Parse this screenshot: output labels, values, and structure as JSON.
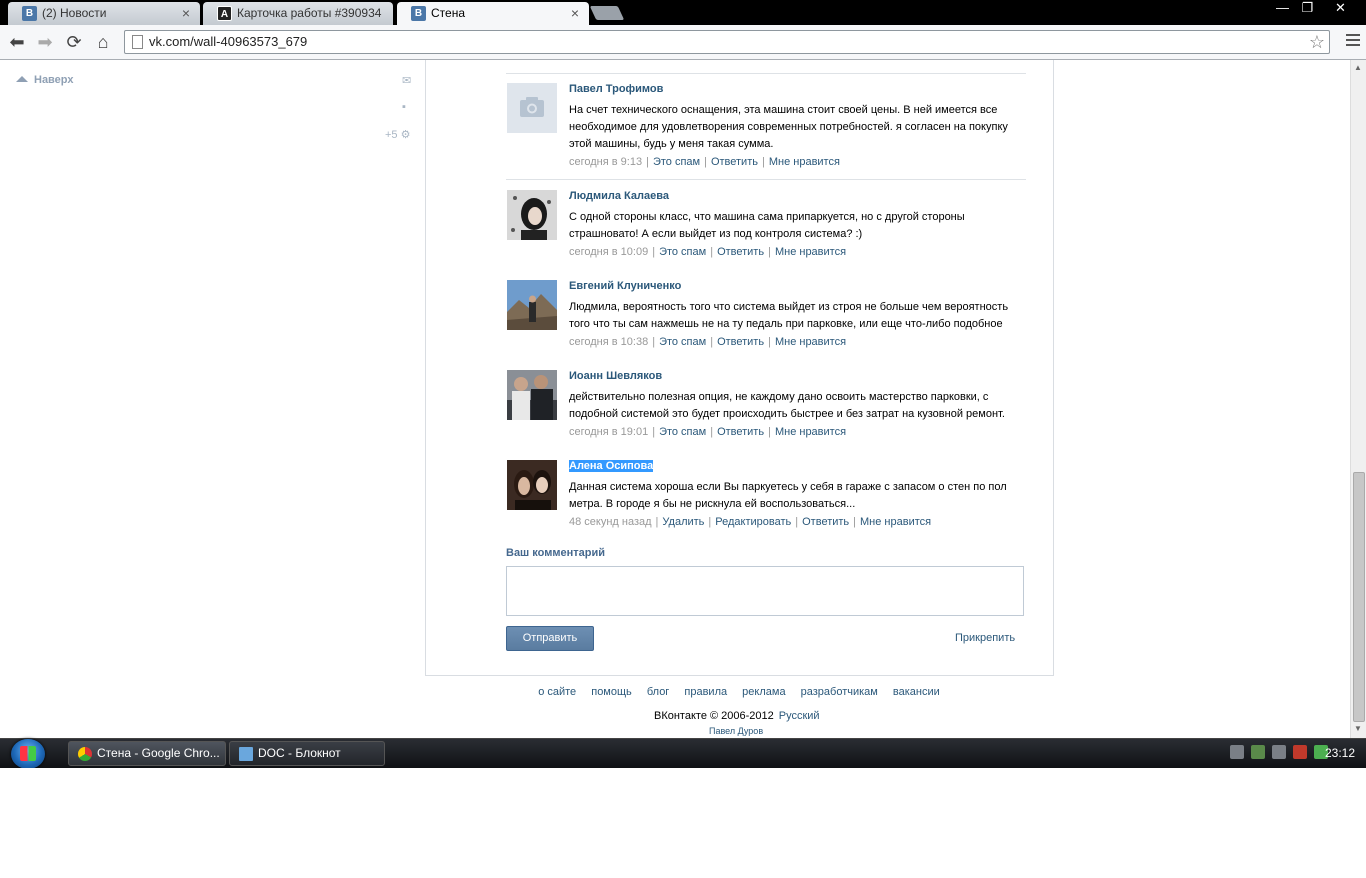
{
  "browser": {
    "tabs": [
      {
        "label": "(2) Новости",
        "favicon_letter": "В",
        "favicon_color": "#4b77a8",
        "active": false
      },
      {
        "label": "Карточка работы #390934",
        "favicon_letter": "A",
        "favicon_color": "#222222",
        "active": false
      },
      {
        "label": "Стена",
        "favicon_letter": "В",
        "favicon_color": "#4b77a8",
        "active": true
      }
    ],
    "url": "vk.com/wall-40963573_679",
    "window_controls": {
      "minimize": "—",
      "restore": "❐",
      "close": "✕"
    }
  },
  "sidebar": {
    "to_top_label": "Наверх",
    "counter_label": "+5"
  },
  "comments": [
    {
      "author": "Павел Трофимов",
      "text": "На счет технического оснащения, эта машина стоит своей цены. В ней имеется все необходимое для удовлетворения современных потребностей. я согласен на покупку этой машины, будь у меня такая сумма.",
      "time": "сегодня в 9:13",
      "actions": [
        "Это спам",
        "Ответить",
        "Мне нравится"
      ],
      "avatar": "camera-placeholder"
    },
    {
      "author": "Людмила Калаева",
      "text": "С одной стороны класс, что машина сама припаркуется, но с другой стороны страшновато! А если выйдет из под контроля система? :)",
      "time": "сегодня в 10:09",
      "actions": [
        "Это спам",
        "Ответить",
        "Мне нравится"
      ],
      "avatar": "photo"
    },
    {
      "author": "Евгений Клуниченко",
      "text": "Людмила, вероятность того что система выйдет из строя не больше чем вероятность того что ты сам нажмешь не на ту педаль при парковке, или еще что-либо подобное",
      "time": "сегодня в 10:38",
      "actions": [
        "Это спам",
        "Ответить",
        "Мне нравится"
      ],
      "avatar": "photo"
    },
    {
      "author": "Иоанн Шевляков",
      "text": "действительно полезная опция, не каждому дано освоить мастерство парковки, с подобной системой это будет происходить быстрее и без затрат на кузовной ремонт.",
      "time": "сегодня в 19:01",
      "actions": [
        "Это спам",
        "Ответить",
        "Мне нравится"
      ],
      "avatar": "photo"
    },
    {
      "author": "Алена Осипова",
      "text": "Данная система хороша если Вы паркуетесь у себя в гараже с запасом о стен по пол метра. В городе я бы не рискнула ей воспользоваться...",
      "time": "48 секунд назад",
      "actions": [
        "Удалить",
        "Редактировать",
        "Ответить",
        "Мне нравится"
      ],
      "avatar": "photo"
    }
  ],
  "compose": {
    "label": "Ваш комментарий",
    "placeholder": "",
    "send_label": "Отправить",
    "attach_label": "Прикрепить"
  },
  "footer": {
    "links": [
      "о сайте",
      "помощь",
      "блог",
      "правила",
      "реклама",
      "разработчикам",
      "вакансии"
    ],
    "copyright": "ВКонтакте © 2006-2012",
    "language": "Русский",
    "founder": "Павел Дуров"
  },
  "taskbar": {
    "buttons": [
      {
        "label": "Стена - Google Chro...",
        "active": true
      },
      {
        "label": "DOC - Блокнот",
        "active": false
      }
    ],
    "clock": "23:12"
  },
  "colors": {
    "link": "#2b587a",
    "accent": "#5a7ca0",
    "muted": "#999999"
  }
}
